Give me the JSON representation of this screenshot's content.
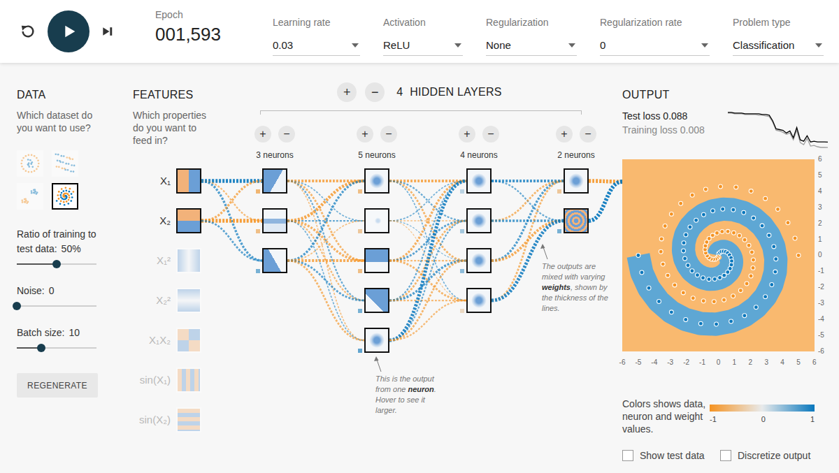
{
  "toolbar": {
    "running": false,
    "epoch": {
      "label": "Epoch",
      "value": "001,593"
    },
    "dropdowns": [
      {
        "label": "Learning rate",
        "value": "0.03"
      },
      {
        "label": "Activation",
        "value": "ReLU"
      },
      {
        "label": "Regularization",
        "value": "None"
      },
      {
        "label": "Regularization rate",
        "value": "0"
      },
      {
        "label": "Problem type",
        "value": "Classification"
      }
    ]
  },
  "data_panel": {
    "title": "DATA",
    "prompt": "Which dataset do you want to use?",
    "datasets": [
      {
        "kind": "circle",
        "selected": false
      },
      {
        "kind": "xor",
        "selected": false
      },
      {
        "kind": "gauss",
        "selected": false
      },
      {
        "kind": "spiral",
        "selected": true
      }
    ],
    "sliders": [
      {
        "label": "Ratio of training to test data:",
        "reading": "50%",
        "level": 0.5
      },
      {
        "label": "Noise:",
        "reading": "0",
        "level": 0
      },
      {
        "label": "Batch size:",
        "reading": "10",
        "level": 0.31
      }
    ],
    "button": "REGENERATE"
  },
  "features_panel": {
    "title": "FEATURES",
    "prompt": "Which properties do you want to feed in?",
    "features": [
      {
        "label": "X₁",
        "kind": "x1",
        "active": true
      },
      {
        "label": "X₂",
        "kind": "x2",
        "active": true
      },
      {
        "label": "X₁²",
        "kind": "x1sq",
        "active": false
      },
      {
        "label": "X₂²",
        "kind": "x2sq",
        "active": false
      },
      {
        "label": "X₁X₂",
        "kind": "x1x2",
        "active": false
      },
      {
        "label": "sin(X₁)",
        "kind": "sinx1",
        "active": false
      },
      {
        "label": "sin(X₂)",
        "kind": "sinx2",
        "active": false
      }
    ]
  },
  "network": {
    "add": "+",
    "remove": "−",
    "layer_count": "4",
    "layers_label": "HIDDEN LAYERS",
    "layers": [
      {
        "add": "+",
        "remove": "−",
        "neurons_label": "3 neurons",
        "neurons": [
          {
            "kind": "diag",
            "bias": -0.6
          },
          {
            "kind": "horiz",
            "bias": -0.5
          },
          {
            "kind": "diag2",
            "bias": 0.5
          }
        ],
        "weights": [
          [
            0.9,
            -0.3,
            0.5
          ],
          [
            -0.5,
            -0.9,
            0.4
          ]
        ]
      },
      {
        "add": "+",
        "remove": "−",
        "neurons_label": "5 neurons",
        "neurons": [
          {
            "kind": "blob",
            "bias": -0.5
          },
          {
            "kind": "faint",
            "bias": -0.4
          },
          {
            "kind": "upper",
            "bias": -0.5
          },
          {
            "kind": "corner",
            "bias": 0.5
          },
          {
            "kind": "blob",
            "bias": 0.6
          }
        ],
        "weights": [
          [
            -0.6,
            0.2,
            -0.4,
            0.3,
            -0.2
          ],
          [
            -0.7,
            0.3,
            -0.5,
            -0.3,
            0.2
          ],
          [
            0.5,
            -0.2,
            -0.6,
            0.4,
            -0.4
          ]
        ]
      },
      {
        "add": "+",
        "remove": "−",
        "neurons_label": "4 neurons",
        "neurons": [
          {
            "kind": "blob",
            "bias": 0.2
          },
          {
            "kind": "blob",
            "bias": 0.3
          },
          {
            "kind": "blob",
            "bias": 0.4
          },
          {
            "kind": "blob",
            "bias": -0.2
          }
        ],
        "weights": [
          [
            -0.6,
            0.3,
            -0.4,
            0.2
          ],
          [
            0.2,
            -0.2,
            0.1,
            -0.1
          ],
          [
            -0.5,
            0.4,
            -0.3,
            -0.4
          ],
          [
            0.3,
            -0.4,
            0.5,
            -0.3
          ],
          [
            0.8,
            0.3,
            -0.4,
            -0.3
          ]
        ]
      },
      {
        "add": "+",
        "remove": "−",
        "neurons_label": "2 neurons",
        "neurons": [
          {
            "kind": "blob",
            "bias": -0.4
          },
          {
            "kind": "spiral",
            "bias": 0.5
          }
        ],
        "weights": [
          [
            0.6,
            0.3
          ],
          [
            -0.4,
            0.5
          ],
          [
            0.5,
            -0.6
          ],
          [
            -0.4,
            0.8
          ]
        ]
      }
    ],
    "output_weights": [
      -0.9,
      0.95
    ],
    "notes": [
      {
        "parts": [
          {
            "text": "This is the output from one ",
            "bold": false
          },
          {
            "text": "neuron",
            "bold": true
          },
          {
            "text": ". Hover to see it larger.",
            "bold": false
          }
        ]
      },
      {
        "parts": [
          {
            "text": "The outputs are mixed with varying ",
            "bold": false
          },
          {
            "text": "weights",
            "bold": true
          },
          {
            "text": ", shown by the thickness of the lines.",
            "bold": false
          }
        ]
      }
    ]
  },
  "output": {
    "title": "OUTPUT",
    "test_loss": "Test loss 0.088",
    "training_loss": "Training loss 0.008",
    "loss_chart": {
      "series": [
        {
          "color": "#9e9e9e",
          "values": [
            0.51,
            0.51,
            0.5,
            0.5,
            0.5,
            0.49,
            0.49,
            0.49,
            0.49,
            0.48,
            0.48,
            0.47,
            0.46,
            0.38,
            0.26,
            0.25,
            0.23,
            0.2,
            0.22,
            0.12,
            0.26,
            0.08,
            0.05,
            0.14,
            0.03,
            0.04,
            0.02,
            0.01,
            0.01,
            0.008
          ]
        },
        {
          "color": "#000000",
          "values": [
            0.52,
            0.52,
            0.51,
            0.51,
            0.51,
            0.5,
            0.5,
            0.5,
            0.5,
            0.5,
            0.49,
            0.49,
            0.48,
            0.4,
            0.28,
            0.27,
            0.26,
            0.22,
            0.25,
            0.15,
            0.3,
            0.12,
            0.1,
            0.18,
            0.09,
            0.1,
            0.09,
            0.09,
            0.09,
            0.088
          ]
        }
      ]
    },
    "plot": {
      "series": [
        {
          "color": "#0877bd",
          "points": [
            [
              0.02,
              0.1
            ],
            [
              0.09,
              0.18
            ],
            [
              0.18,
              0.24
            ],
            [
              0.31,
              0.25
            ],
            [
              0.45,
              0.23
            ],
            [
              0.58,
              0.15
            ],
            [
              0.7,
              0.02
            ],
            [
              0.79,
              -0.15
            ],
            [
              0.83,
              -0.36
            ],
            [
              0.81,
              -0.59
            ],
            [
              0.73,
              -0.83
            ],
            [
              0.58,
              -1.05
            ],
            [
              0.36,
              -1.25
            ],
            [
              0.09,
              -1.4
            ],
            [
              -0.23,
              -1.48
            ],
            [
              -0.59,
              -1.49
            ],
            [
              -0.96,
              -1.41
            ],
            [
              -1.31,
              -1.23
            ],
            [
              -1.64,
              -0.97
            ],
            [
              -1.9,
              -0.62
            ],
            [
              -2.09,
              -0.2
            ],
            [
              -2.18,
              0.28
            ],
            [
              -2.16,
              0.78
            ],
            [
              -2.03,
              1.29
            ],
            [
              -1.77,
              1.77
            ],
            [
              -1.39,
              2.19
            ],
            [
              -0.92,
              2.54
            ],
            [
              -0.35,
              2.78
            ],
            [
              0.27,
              2.89
            ],
            [
              0.93,
              2.85
            ],
            [
              1.58,
              2.67
            ],
            [
              2.19,
              2.33
            ],
            [
              2.73,
              1.85
            ],
            [
              3.16,
              1.25
            ],
            [
              3.46,
              0.55
            ],
            [
              3.59,
              -0.23
            ],
            [
              3.55,
              -1.03
            ],
            [
              3.33,
              -1.83
            ],
            [
              2.93,
              -2.58
            ],
            [
              2.35,
              -3.24
            ],
            [
              1.63,
              -3.76
            ],
            [
              0.79,
              -4.12
            ],
            [
              -0.13,
              -4.3
            ],
            [
              -1.1,
              -4.26
            ],
            [
              -2.04,
              -4.01
            ],
            [
              -2.93,
              -3.55
            ],
            [
              -3.71,
              -2.88
            ],
            [
              -4.34,
              -2.04
            ],
            [
              -4.78,
              -1.07
            ],
            [
              -5.0,
              0.0
            ]
          ]
        },
        {
          "color": "#f59322",
          "points": [
            [
              -0.02,
              -0.1
            ],
            [
              -0.09,
              -0.18
            ],
            [
              -0.18,
              -0.24
            ],
            [
              -0.31,
              -0.25
            ],
            [
              -0.45,
              -0.23
            ],
            [
              -0.58,
              -0.15
            ],
            [
              -0.7,
              -0.02
            ],
            [
              -0.79,
              0.15
            ],
            [
              -0.83,
              0.36
            ],
            [
              -0.81,
              0.59
            ],
            [
              -0.73,
              0.83
            ],
            [
              -0.58,
              1.05
            ],
            [
              -0.36,
              1.25
            ],
            [
              -0.09,
              1.4
            ],
            [
              0.23,
              1.48
            ],
            [
              0.59,
              1.49
            ],
            [
              0.96,
              1.41
            ],
            [
              1.31,
              1.23
            ],
            [
              1.64,
              0.97
            ],
            [
              1.9,
              0.62
            ],
            [
              2.09,
              0.2
            ],
            [
              2.18,
              -0.28
            ],
            [
              2.16,
              -0.78
            ],
            [
              2.03,
              -1.29
            ],
            [
              1.77,
              -1.77
            ],
            [
              1.39,
              -2.19
            ],
            [
              0.92,
              -2.54
            ],
            [
              0.35,
              -2.78
            ],
            [
              -0.27,
              -2.89
            ],
            [
              -0.93,
              -2.85
            ],
            [
              -1.58,
              -2.67
            ],
            [
              -2.19,
              -2.33
            ],
            [
              -2.73,
              -1.85
            ],
            [
              -3.16,
              -1.25
            ],
            [
              -3.46,
              -0.55
            ],
            [
              -3.59,
              0.23
            ],
            [
              -3.55,
              1.03
            ],
            [
              -3.33,
              1.83
            ],
            [
              -2.93,
              2.58
            ],
            [
              -2.35,
              3.24
            ],
            [
              -1.63,
              3.76
            ],
            [
              -0.79,
              4.12
            ],
            [
              0.13,
              4.3
            ],
            [
              1.1,
              4.26
            ],
            [
              2.04,
              4.01
            ],
            [
              2.93,
              3.55
            ],
            [
              3.71,
              2.88
            ],
            [
              4.34,
              2.04
            ],
            [
              4.78,
              1.07
            ],
            [
              5.0,
              0.0
            ]
          ]
        }
      ],
      "x_ticks": [
        "-6",
        "-5",
        "-4",
        "-3",
        "-2",
        "-1",
        "0",
        "1",
        "2",
        "3",
        "4",
        "5",
        "6"
      ],
      "y_ticks": [
        "6",
        "5",
        "4",
        "3",
        "2",
        "1",
        "0",
        "-1",
        "-2",
        "-3",
        "-4",
        "-5",
        "-6"
      ]
    },
    "legend": {
      "caption": "Colors shows data, neuron and weight values.",
      "ticks": [
        "-1",
        "0",
        "1"
      ]
    },
    "checkboxes": [
      {
        "label": "Show test data",
        "checked": false
      },
      {
        "label": "Discretize output",
        "checked": false
      }
    ]
  }
}
